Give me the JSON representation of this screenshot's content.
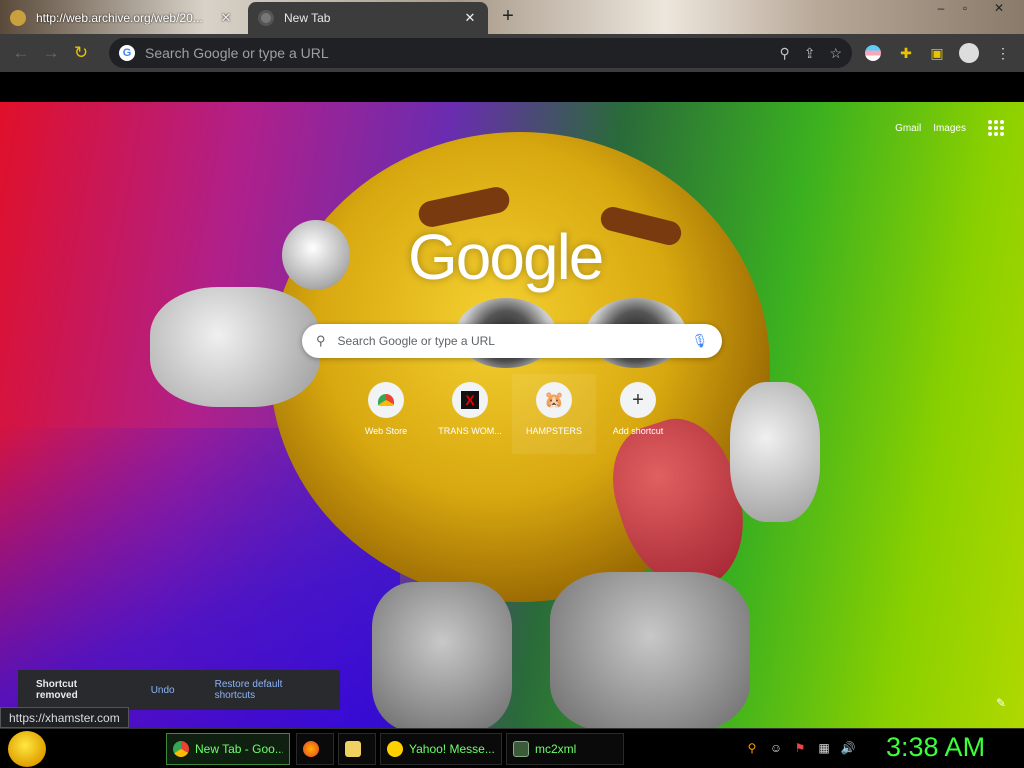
{
  "tabs": [
    {
      "title": "http://web.archive.org/web/20...",
      "active": false
    },
    {
      "title": "New Tab",
      "active": true
    }
  ],
  "toolbar": {
    "omnibox_placeholder": "Search Google or type a URL"
  },
  "ntp": {
    "links": [
      "Gmail",
      "Images"
    ],
    "logo": "Google",
    "search_placeholder": "Search Google or type a URL",
    "shortcuts": [
      {
        "label": "Web Store",
        "icon": "webstore-icon"
      },
      {
        "label": "TRANS WOM...",
        "icon": "x-icon"
      },
      {
        "label": "HAMPSTERS",
        "icon": "hamster-icon"
      },
      {
        "label": "Add shortcut",
        "icon": "plus-icon"
      }
    ],
    "toast": {
      "message": "Shortcut removed",
      "undo": "Undo",
      "restore": "Restore default shortcuts"
    }
  },
  "status_url": "https://xhamster.com",
  "taskbar": {
    "tasks": [
      {
        "label": "New Tab - Goo...",
        "icon": "chrome-icon",
        "active": true
      },
      {
        "label": "",
        "icon": "firefox-icon",
        "active": false
      },
      {
        "label": "",
        "icon": "folder-icon",
        "active": false
      },
      {
        "label": "Yahoo! Messe...",
        "icon": "yahoo-messenger-icon",
        "active": false
      },
      {
        "label": "mc2xml",
        "icon": "mc2xml-icon",
        "active": false
      }
    ],
    "clock": "3:38 AM"
  },
  "colors": {
    "accent_green": "#3bff3b",
    "toolbar": "#3c3c3c",
    "toast_bg": "#292a2d",
    "link_blue": "#8ab4f8"
  }
}
